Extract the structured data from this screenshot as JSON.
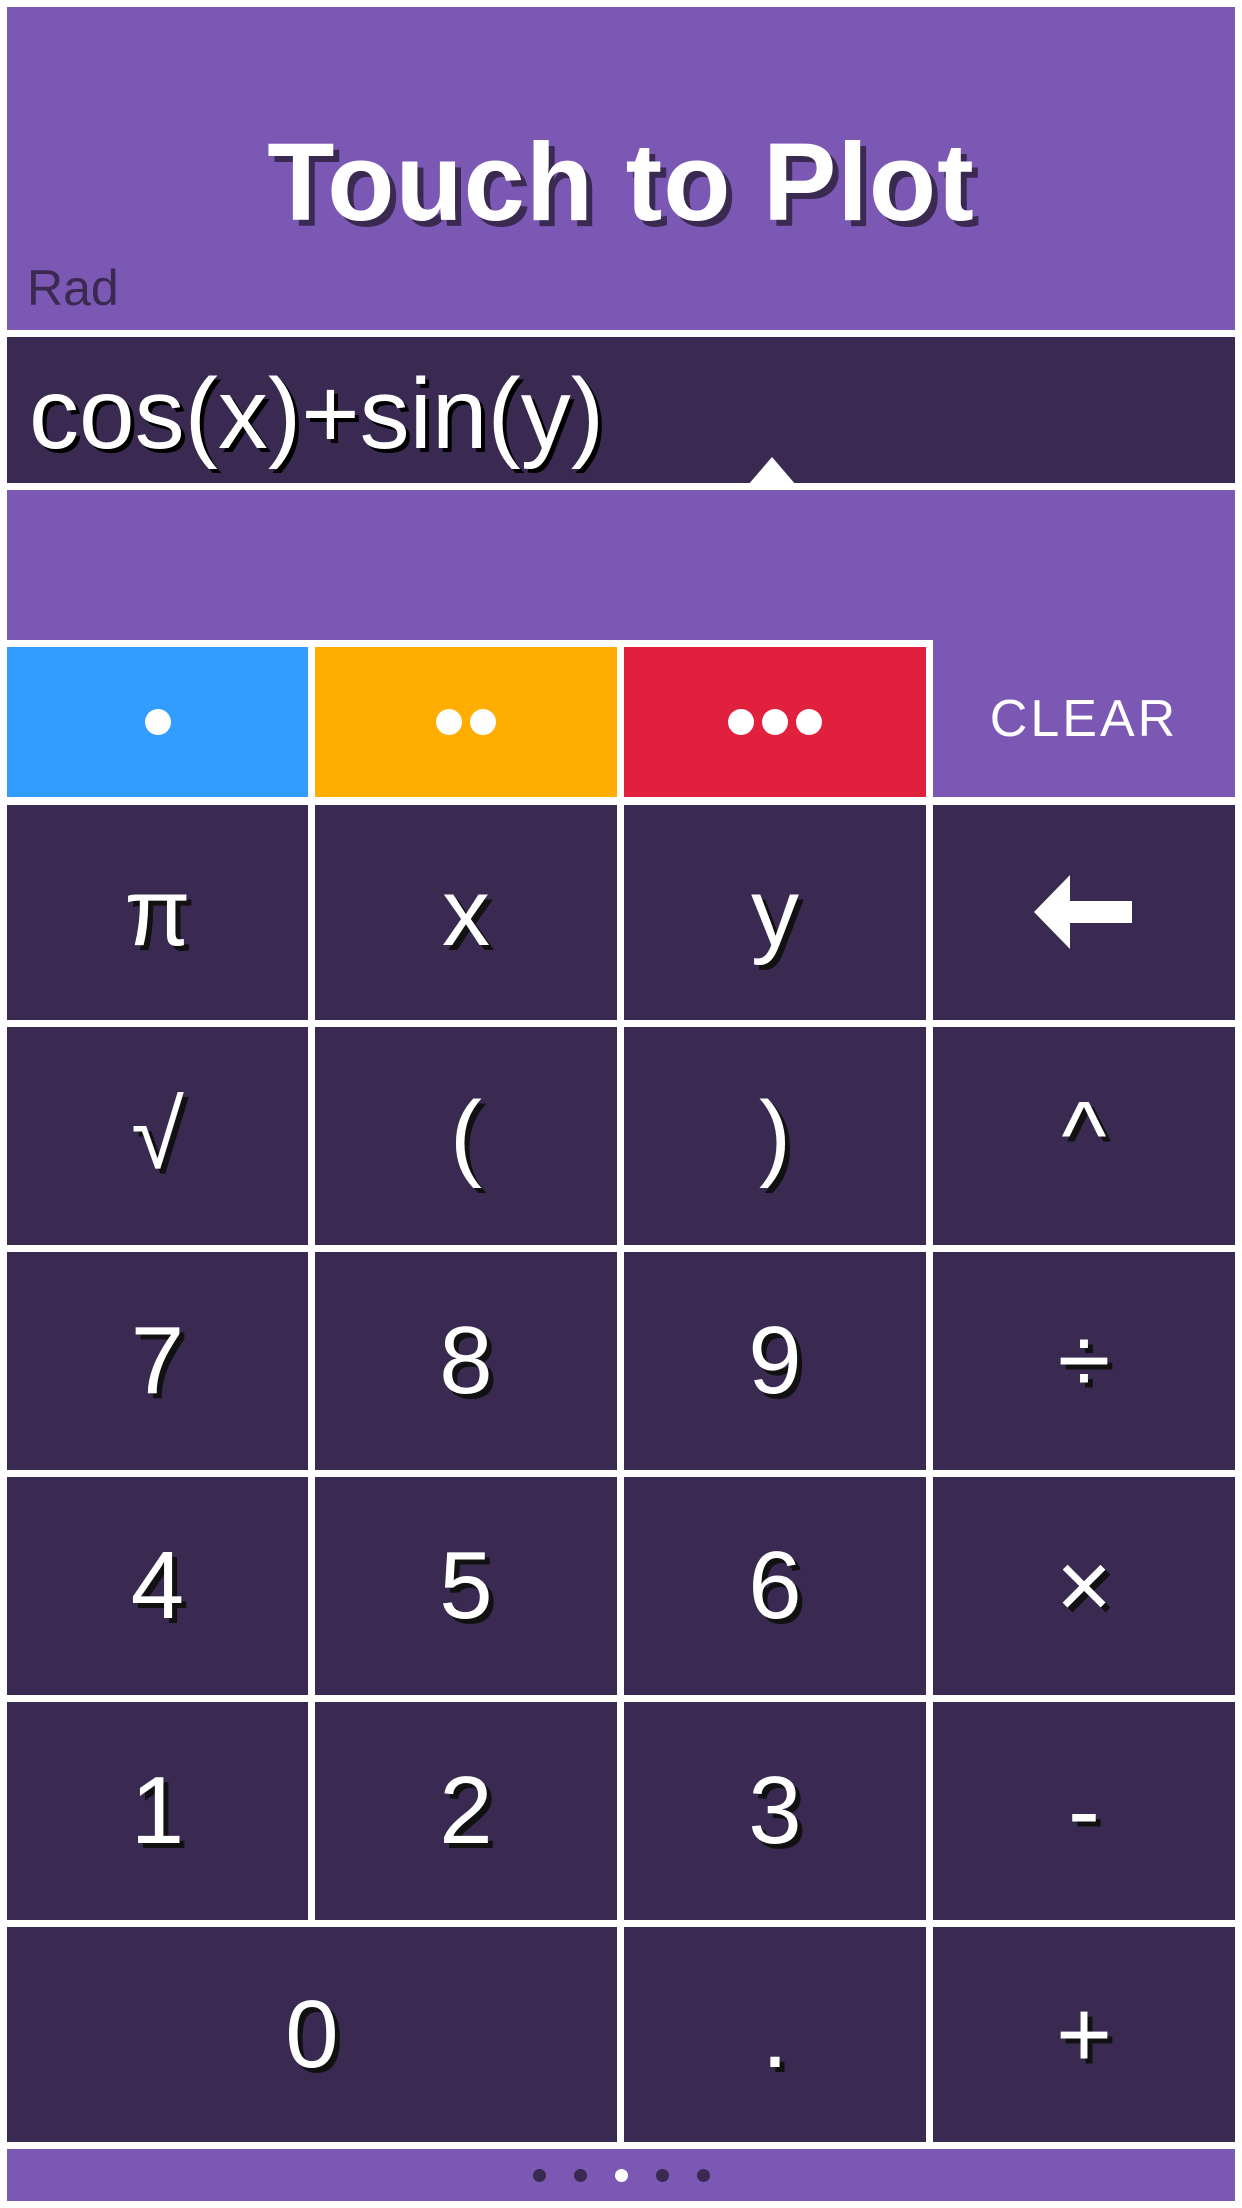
{
  "header": {
    "title": "Touch to Plot",
    "angle_mode": "Rad"
  },
  "expression": {
    "value": "cos(x)+sin(y)"
  },
  "color_buttons": [
    {
      "name": "function-1",
      "dots": 1,
      "color": "#339cff"
    },
    {
      "name": "function-2",
      "dots": 2,
      "color": "#ffad00"
    },
    {
      "name": "function-3",
      "dots": 3,
      "color": "#e0203d"
    }
  ],
  "clear_label": "CLEAR",
  "keypad": [
    [
      {
        "label": "π",
        "name": "pi"
      },
      {
        "label": "x",
        "name": "x"
      },
      {
        "label": "y",
        "name": "y"
      },
      {
        "label": "←",
        "name": "backspace",
        "icon": "arrow-left-icon"
      }
    ],
    [
      {
        "label": "√",
        "name": "sqrt"
      },
      {
        "label": "(",
        "name": "open-paren"
      },
      {
        "label": ")",
        "name": "close-paren"
      },
      {
        "label": "^",
        "name": "power"
      }
    ],
    [
      {
        "label": "7",
        "name": "7"
      },
      {
        "label": "8",
        "name": "8"
      },
      {
        "label": "9",
        "name": "9"
      },
      {
        "label": "÷",
        "name": "divide"
      }
    ],
    [
      {
        "label": "4",
        "name": "4"
      },
      {
        "label": "5",
        "name": "5"
      },
      {
        "label": "6",
        "name": "6"
      },
      {
        "label": "×",
        "name": "multiply"
      }
    ],
    [
      {
        "label": "1",
        "name": "1"
      },
      {
        "label": "2",
        "name": "2"
      },
      {
        "label": "3",
        "name": "3"
      },
      {
        "label": "-",
        "name": "minus"
      }
    ],
    [
      {
        "label": "0",
        "name": "0",
        "span": 2
      },
      {
        "label": ".",
        "name": "decimal"
      },
      {
        "label": "+",
        "name": "plus"
      }
    ]
  ],
  "pager": {
    "count": 5,
    "active_index": 2
  },
  "colors": {
    "primary": "#7b58b3",
    "dark": "#3a2a52",
    "background": "#ffffff"
  }
}
